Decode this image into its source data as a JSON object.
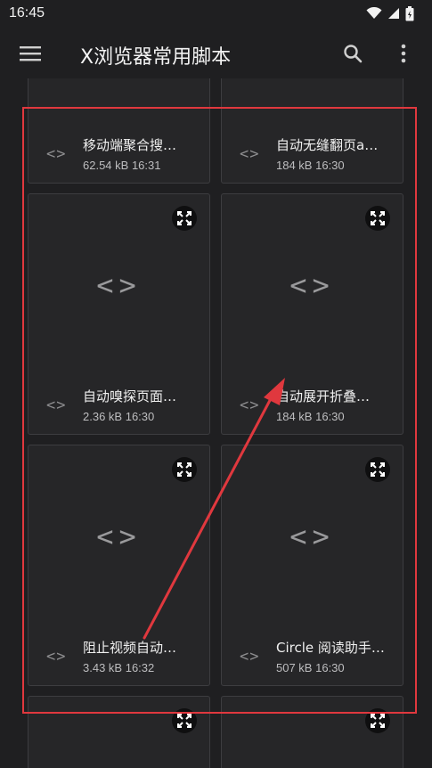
{
  "status_bar": {
    "time": "16:45"
  },
  "app_bar": {
    "title": "X浏览器常用脚本",
    "menu_icon": "menu-icon",
    "search_icon": "search-icon",
    "more_icon": "more-vert-icon"
  },
  "scripts": [
    {
      "name": "移动端聚合搜…",
      "size": "62.54 kB",
      "time": "16:31"
    },
    {
      "name": "自动无缝翻页a…",
      "size": "184 kB",
      "time": "16:30"
    },
    {
      "name": "自动嗅探页面…",
      "size": "2.36 kB",
      "time": "16:30"
    },
    {
      "name": "自动展开折叠…",
      "size": "184 kB",
      "time": "16:30"
    },
    {
      "name": "阻止视频自动…",
      "size": "3.43 kB",
      "time": "16:32"
    },
    {
      "name": "Circle 阅读助手…",
      "size": "507 kB",
      "time": "16:30"
    }
  ],
  "code_symbol": "<>",
  "annotation_color": "#e0383e"
}
